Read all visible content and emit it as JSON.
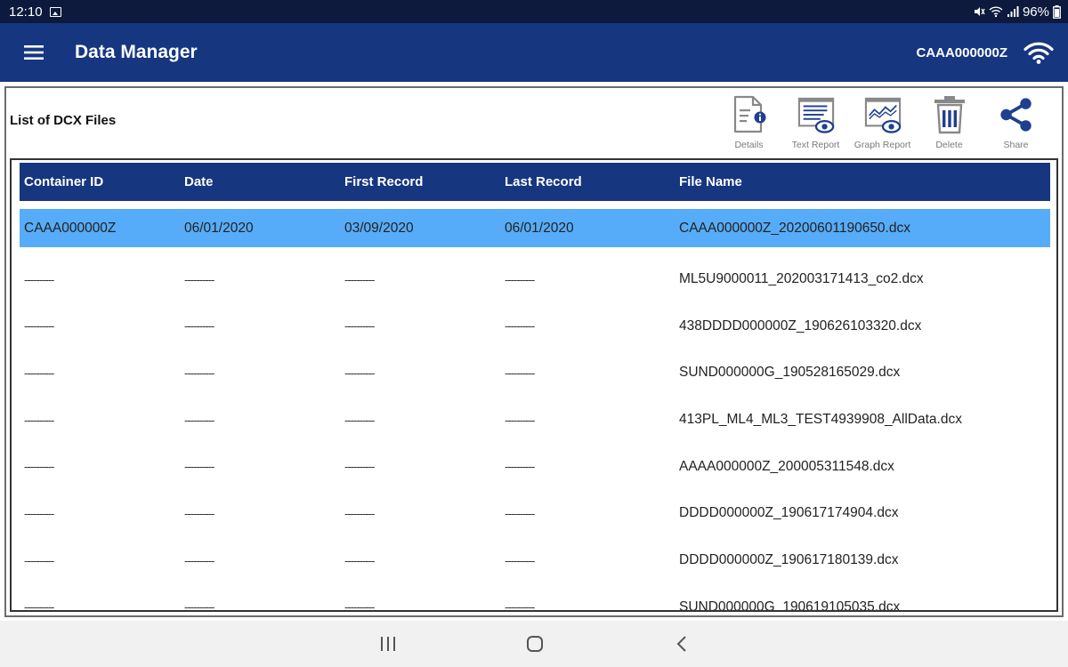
{
  "status_bar": {
    "time": "12:10",
    "battery": "96%"
  },
  "app_bar": {
    "title": "Data Manager",
    "device_id": "CAAA000000Z"
  },
  "panel": {
    "title": "List of DCX Files"
  },
  "toolbar": {
    "details": "Details",
    "text_report": "Text Report",
    "graph_report": "Graph Report",
    "delete": "Delete",
    "share": "Share"
  },
  "table": {
    "columns": [
      "Container ID",
      "Date",
      "First Record",
      "Last Record",
      "File Name"
    ],
    "rows": [
      [
        "CAAA000000Z",
        "06/01/2020",
        "03/09/2020",
        "06/01/2020",
        "CAAA000000Z_20200601190650.dcx"
      ],
      [
        "----------",
        "----------",
        "----------",
        "----------",
        "ML5U9000011_202003171413_co2.dcx"
      ],
      [
        "----------",
        "----------",
        "----------",
        "----------",
        "438DDDD000000Z_190626103320.dcx"
      ],
      [
        "----------",
        "----------",
        "----------",
        "----------",
        "SUND000000G_190528165029.dcx"
      ],
      [
        "----------",
        "----------",
        "----------",
        "----------",
        "413PL_ML4_ML3_TEST4939908_AllData.dcx"
      ],
      [
        "----------",
        "----------",
        "----------",
        "----------",
        "AAAA000000Z_200005311548.dcx"
      ],
      [
        "----------",
        "----------",
        "----------",
        "----------",
        "DDDD000000Z_190617174904.dcx"
      ],
      [
        "----------",
        "----------",
        "----------",
        "----------",
        "DDDD000000Z_190617180139.dcx"
      ],
      [
        "----------",
        "----------",
        "----------",
        "----------",
        "SUND000000G_190619105035.dcx"
      ]
    ]
  },
  "colors": {
    "app_bar": "#163680",
    "status_bar": "#0d1a3e",
    "selected_row": "#56acf8",
    "icon_blue": "#1f3f8f"
  }
}
